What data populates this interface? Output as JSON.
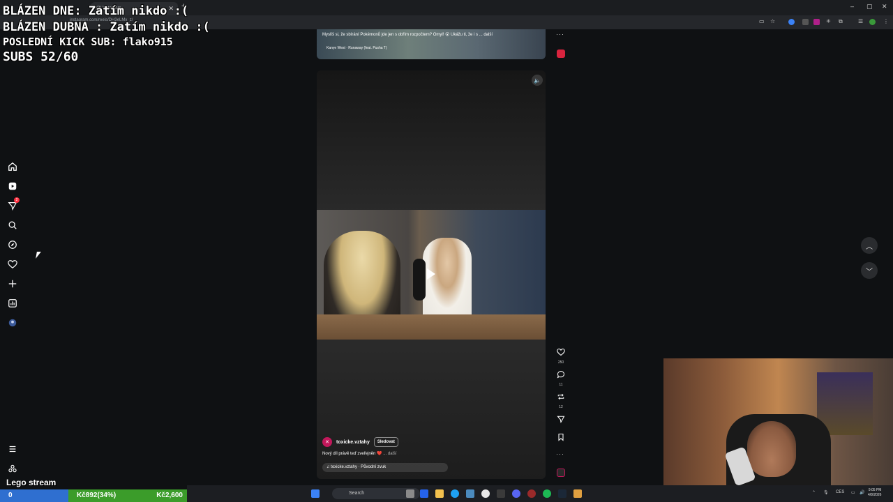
{
  "browser": {
    "tab_title": "(2) Instagram",
    "url": "instagram.com/reels/DH3eLMx_z/",
    "window_controls": [
      "–",
      "▢",
      "✕"
    ],
    "new_tab": "+",
    "tab_close": "✕"
  },
  "overlay": {
    "line1": "BLÁZEN DNE: Zatím nikdo :(",
    "line2": "BLÁZEN DUBNA : Zatím nikdo :(",
    "line3": "POSLEDNÍ KICK SUB: flako915",
    "line4": "SUBS 52/60"
  },
  "nav": {
    "notification_count": "2",
    "icons": [
      "home-icon",
      "reels-icon",
      "direct-message-icon",
      "search-icon",
      "explore-icon",
      "heart-icon",
      "create-icon",
      "dashboard-icon",
      "profile-icon",
      "menu-icon",
      "threads-icon"
    ]
  },
  "previous_reel": {
    "caption": "Myslíš si, že sbírání Pokémonů jde jen s obřím rozpočtem? Omyl! 😮 Ukážu ti, že i s ... další",
    "audio": "Kanye West · Runaway (feat. Pusha T)"
  },
  "reel": {
    "author": "toxicke.vztahy",
    "follow_label": "Sledovat",
    "caption": "Nový díl právě teď zveřejněn ❤️",
    "caption_more": "... další",
    "audio": "toxicke.vztahy · Původní zvuk",
    "likes": "250",
    "comments": "11",
    "reposts": "12"
  },
  "stream": {
    "label": "Lego stream",
    "goal_blue": "0",
    "goal_progress": "Kč892(34%)",
    "goal_total": "Kč2,600",
    "goal_fraction": 0.34
  },
  "taskbar": {
    "search_placeholder": "Search",
    "language": "CES",
    "time": "9:05 PM",
    "date": "4/8/2026"
  },
  "colors": {
    "accent_red": "#ff3040",
    "goal_blue": "#2f6fd0",
    "goal_green": "#3b9c2a"
  }
}
